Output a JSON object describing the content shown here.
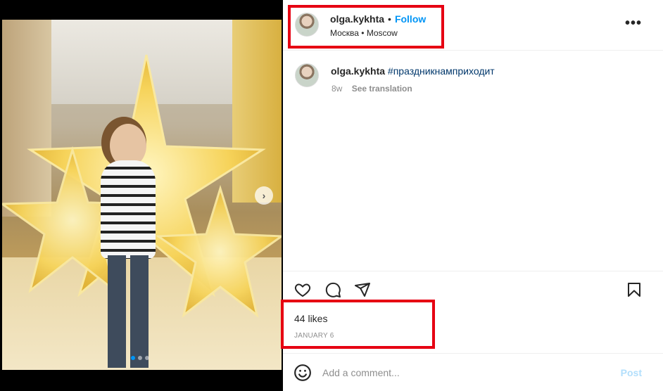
{
  "post": {
    "username": "olga.kykhta",
    "follow_label": "Follow",
    "separator": "•",
    "location": "Москва • Moscow",
    "more_icon": "more-horizontal-icon"
  },
  "caption": {
    "username": "olga.kykhta",
    "hashtag": "#праздникнамприходит",
    "age": "8w",
    "see_translation": "See translation"
  },
  "actions": {
    "like_icon": "heart-icon",
    "comment_icon": "comment-icon",
    "share_icon": "share-icon",
    "save_icon": "bookmark-icon"
  },
  "stats": {
    "likes": "44 likes",
    "date": "JANUARY 6"
  },
  "comment": {
    "placeholder": "Add a comment...",
    "post_label": "Post",
    "emoji_icon": "emoji-icon"
  },
  "carousel": {
    "slide_count": 3,
    "active_index": 0,
    "next_icon": "chevron-right-icon"
  },
  "colors": {
    "link_blue": "#0095f6",
    "hashtag_blue": "#00376b",
    "highlight_red": "#e60012",
    "muted_gray": "#8e8e8e",
    "post_disabled": "#b2dffc"
  }
}
